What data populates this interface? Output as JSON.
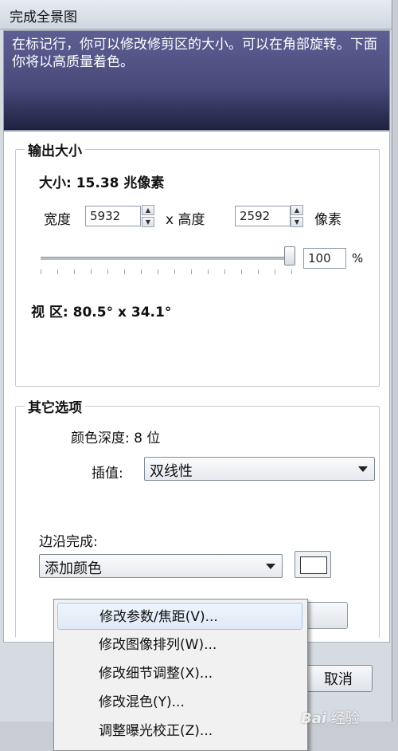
{
  "window": {
    "title": "完成全景图"
  },
  "banner": {
    "text": "在标记行，你可以修改修剪区的大小。可以在角部旋转。下面你将以高质量着色。"
  },
  "output_size": {
    "group_label": "输出大小",
    "size_label": "大小: 15.38 兆像素",
    "width_label": "宽度",
    "width_value": "5932",
    "times_height_label": "x 高度",
    "height_value": "2592",
    "unit_label": "像素",
    "scale_value": "100",
    "scale_percent": 100,
    "percent_sign": "%",
    "view_label": "视 区: 80.5° x 34.1°"
  },
  "other_options": {
    "group_label": "其它选项",
    "color_depth": "颜色深度: 8 位",
    "interpolation_label": "插值:",
    "interpolation_value": "双线性",
    "edge_label": "边沿完成:",
    "edge_value": "添加颜色",
    "edge_color": "#ffffff"
  },
  "buttons": {
    "cancel": "取消"
  },
  "context_menu": {
    "items": [
      {
        "label": "修改参数/焦距(V)..."
      },
      {
        "label": "修改图像排列(W)..."
      },
      {
        "label": "修改细节调整(X)..."
      },
      {
        "label": "修改混色(Y)..."
      },
      {
        "label": "调整曝光校正(Z)..."
      }
    ]
  },
  "watermark": {
    "logo": "Bai",
    "suffix": "经验"
  }
}
